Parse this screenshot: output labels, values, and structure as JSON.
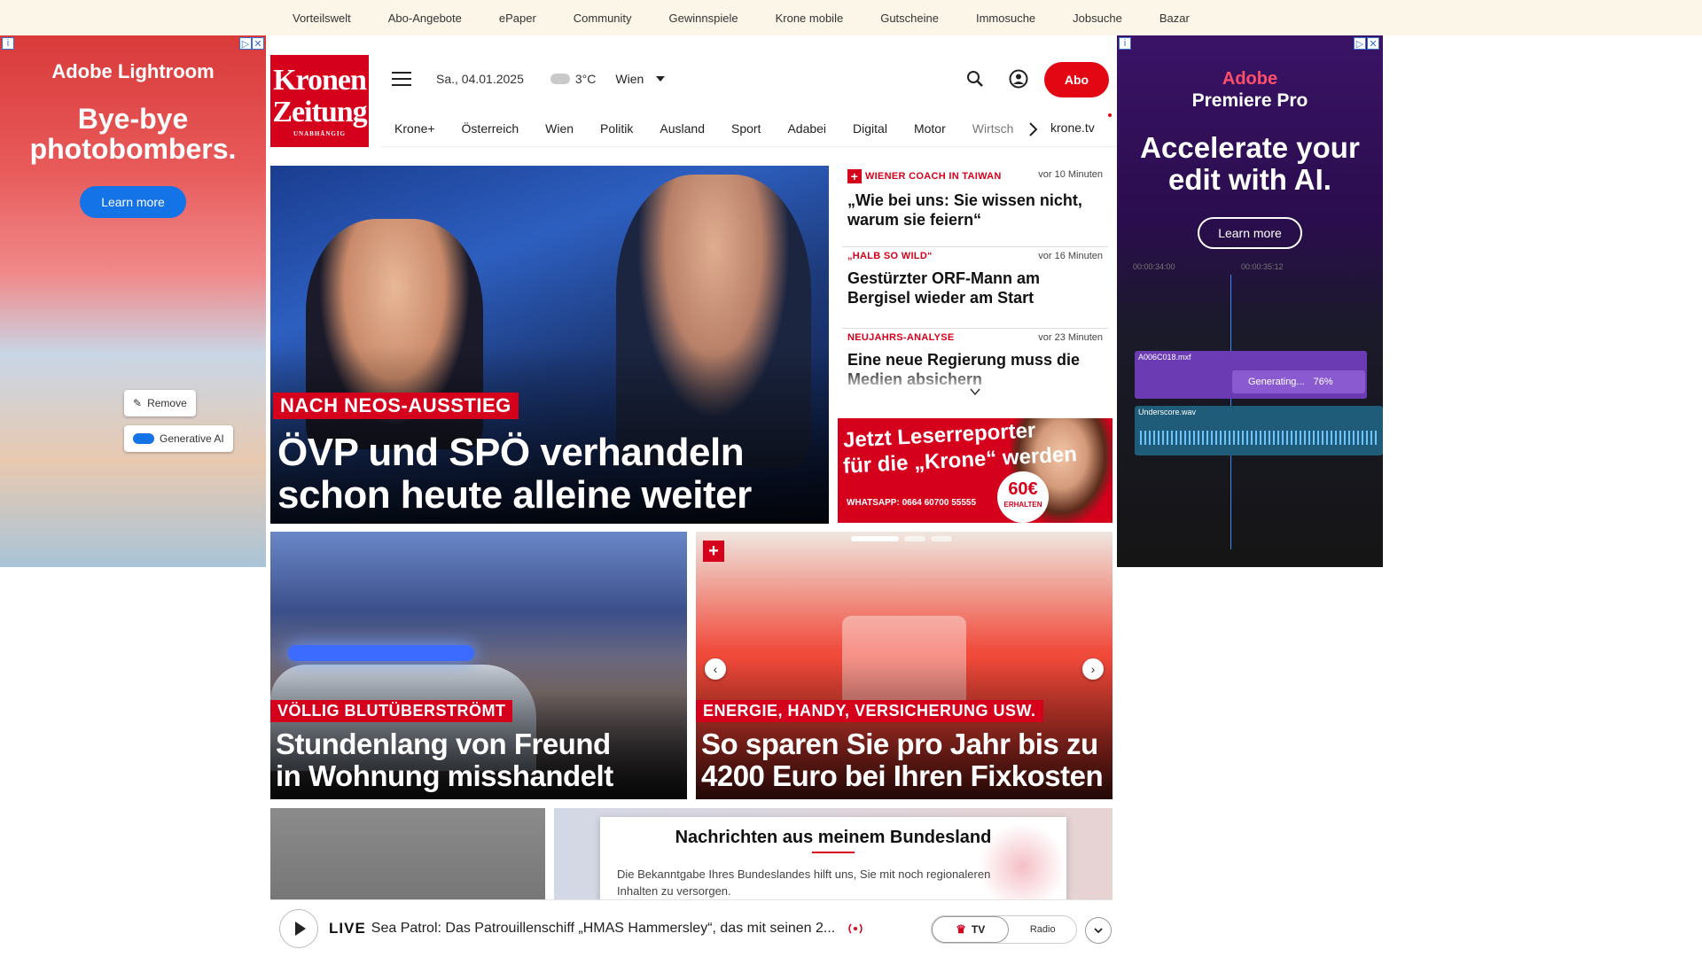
{
  "topbar": {
    "links": [
      "Vorteilswelt",
      "Abo-Angebote",
      "ePaper",
      "Community",
      "Gewinnspiele",
      "Krone mobile",
      "Gutscheine",
      "Immosuche",
      "Jobsuche",
      "Bazar"
    ]
  },
  "logo": {
    "line1": "Kronen",
    "line2": "Zeitung",
    "tag": "UNABHÄNGIG"
  },
  "header": {
    "date": "Sa., 04.01.2025",
    "temp": "3°C",
    "city": "Wien",
    "abo_label": "Abo",
    "icons": {
      "menu": "hamburger-menu-icon",
      "search": "search-icon",
      "account": "user-icon",
      "weather": "cloud-icon"
    }
  },
  "nav": {
    "items": [
      "Krone+",
      "Österreich",
      "Wien",
      "Politik",
      "Ausland",
      "Sport",
      "Adabei",
      "Digital",
      "Motor",
      "Wirtsch"
    ],
    "tv_label": "krone.tv"
  },
  "hero": {
    "kicker": "NACH NEOS-AUSSTIEG",
    "headline_line1": "ÖVP und SPÖ verhandeln",
    "headline_line2": "schon heute alleine weiter"
  },
  "newslist": [
    {
      "kicker": "WIENER COACH IN TAIWAN",
      "plus": true,
      "time": "vor 10 Minuten",
      "title": "„Wie bei uns: Sie wissen nicht, warum sie feiern“"
    },
    {
      "kicker": "„HALB SO WILD“",
      "plus": false,
      "time": "vor 16 Minuten",
      "title": "Gestürzter ORF-Mann am Bergisel wieder am Start"
    },
    {
      "kicker": "NEUJAHRS-ANALYSE",
      "plus": false,
      "time": "vor 23 Minuten",
      "title": "Eine neue Regierung muss die Medien absichern"
    }
  ],
  "promo": {
    "line1": "Jetzt Leserreporter",
    "line2": "für die „Krone“ werden",
    "whatsapp": "WHATSAPP: 0664 60700 55555",
    "badge_value": "60€",
    "badge_label": "ERHALTEN"
  },
  "card1": {
    "kicker": "VÖLLIG BLUTÜBERSTRÖMT",
    "headline_line1": "Stundenlang von Freund",
    "headline_line2": "in Wohnung misshandelt"
  },
  "card2": {
    "kicker": "ENERGIE, HANDY, VERSICHERUNG USW.",
    "headline_line1": "So sparen Sie pro Jahr bis zu",
    "headline_line2": "4200 Euro bei Ihren Fixkosten",
    "prev": "‹",
    "next": "›"
  },
  "popup": {
    "title": "Nachrichten aus meinem Bundesland",
    "body": "Die Bekanntgabe Ihres Bundeslandes hilft uns, Sie mit noch regionaleren Inhalten zu versorgen."
  },
  "player": {
    "live_label": "LIVE",
    "title": "Sea Patrol: Das Patrouillenschiff „HMAS Hammersley“, das mit seinen 2...",
    "tv_label": "TV",
    "radio_label": "Radio"
  },
  "ad_left": {
    "brand": "Adobe Lightroom",
    "headline_line1": "Bye-bye",
    "headline_line2": "photobombers.",
    "button": "Learn more",
    "chip_remove": "Remove",
    "chip_ai": "Generative AI"
  },
  "ad_right": {
    "brand_line1": "Adobe",
    "brand_line2": "Premiere Pro",
    "headline_line1": "Accelerate your",
    "headline_line2": "edit with AI.",
    "button": "Learn more",
    "clip_name": "A006C018.mxf",
    "progress_label": "Generating...",
    "progress_value": "76%",
    "audio_name": "Underscore.wav",
    "time1": "00:00:34:00",
    "time2": "00:00:35:12"
  },
  "colors": {
    "brand_red": "#d5001c",
    "abo_red": "#e30613",
    "topbar_bg": "#fbf6e8"
  }
}
